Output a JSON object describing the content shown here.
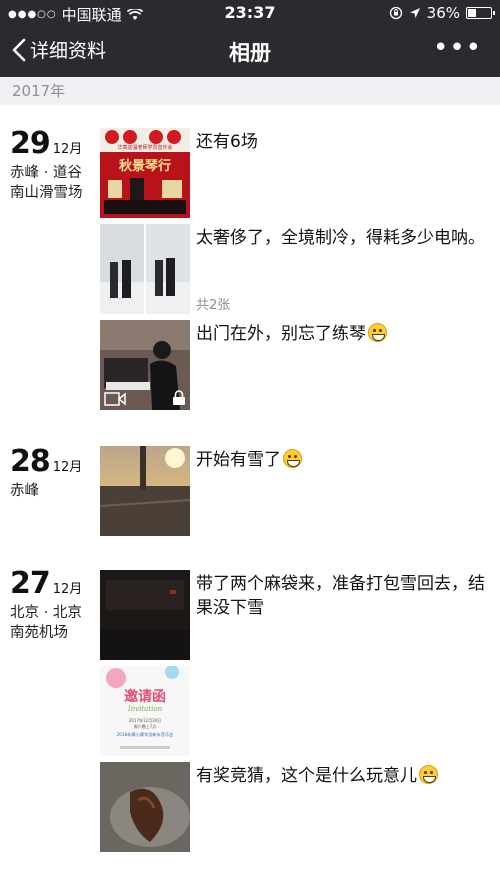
{
  "status_bar": {
    "carrier": "中国联通",
    "time": "23:37",
    "battery": "36%",
    "battery_level": 0.36,
    "icons": [
      "signal-dots-icon",
      "wifi-icon",
      "orientation-lock-icon",
      "location-arrow-icon",
      "battery-icon"
    ]
  },
  "nav": {
    "back_label": "详细资料",
    "title": "相册",
    "more_label": "•••"
  },
  "year": "2017年",
  "days": [
    {
      "day": "29",
      "month": "12月",
      "location": "赤峰 · 道谷南山滑雪场",
      "posts": [
        {
          "text": "还有6场",
          "has_emoji": false,
          "count": "",
          "thumbnail": "concert-poster"
        },
        {
          "text": "太奢侈了，全境制冷，得耗多少电呐。",
          "has_emoji": false,
          "count": "共2张",
          "thumbnail": "snow-photos"
        },
        {
          "text": "出门在外，别忘了练琴",
          "has_emoji": true,
          "count": "",
          "thumbnail": "piano-video"
        }
      ]
    },
    {
      "day": "28",
      "month": "12月",
      "location": "赤峰",
      "posts": [
        {
          "text": "开始有雪了",
          "has_emoji": true,
          "count": "",
          "thumbnail": "sunset"
        }
      ]
    },
    {
      "day": "27",
      "month": "12月",
      "location": "北京 · 北京南苑机场",
      "posts": [
        {
          "text": "带了两个麻袋来，准备打包雪回去，结果没下雪",
          "has_emoji": false,
          "count": "",
          "thumbnail": "dark"
        },
        {
          "text": "",
          "has_emoji": false,
          "count": "",
          "thumbnail": "invitation"
        },
        {
          "text": "有奖竞猜，这个是什么玩意儿",
          "has_emoji": true,
          "count": "",
          "thumbnail": "food"
        }
      ]
    }
  ],
  "thumb_text": {
    "poster_header": "华章店温老师学员音乐会",
    "poster_title": "秋景琴行",
    "invite_title": "邀请函",
    "invite_sub": "Invitation",
    "invite_date": "2017年12月30日",
    "invite_time": "周六晚上7点",
    "invite_event": "2018年赛小赛学员新年音乐会"
  }
}
